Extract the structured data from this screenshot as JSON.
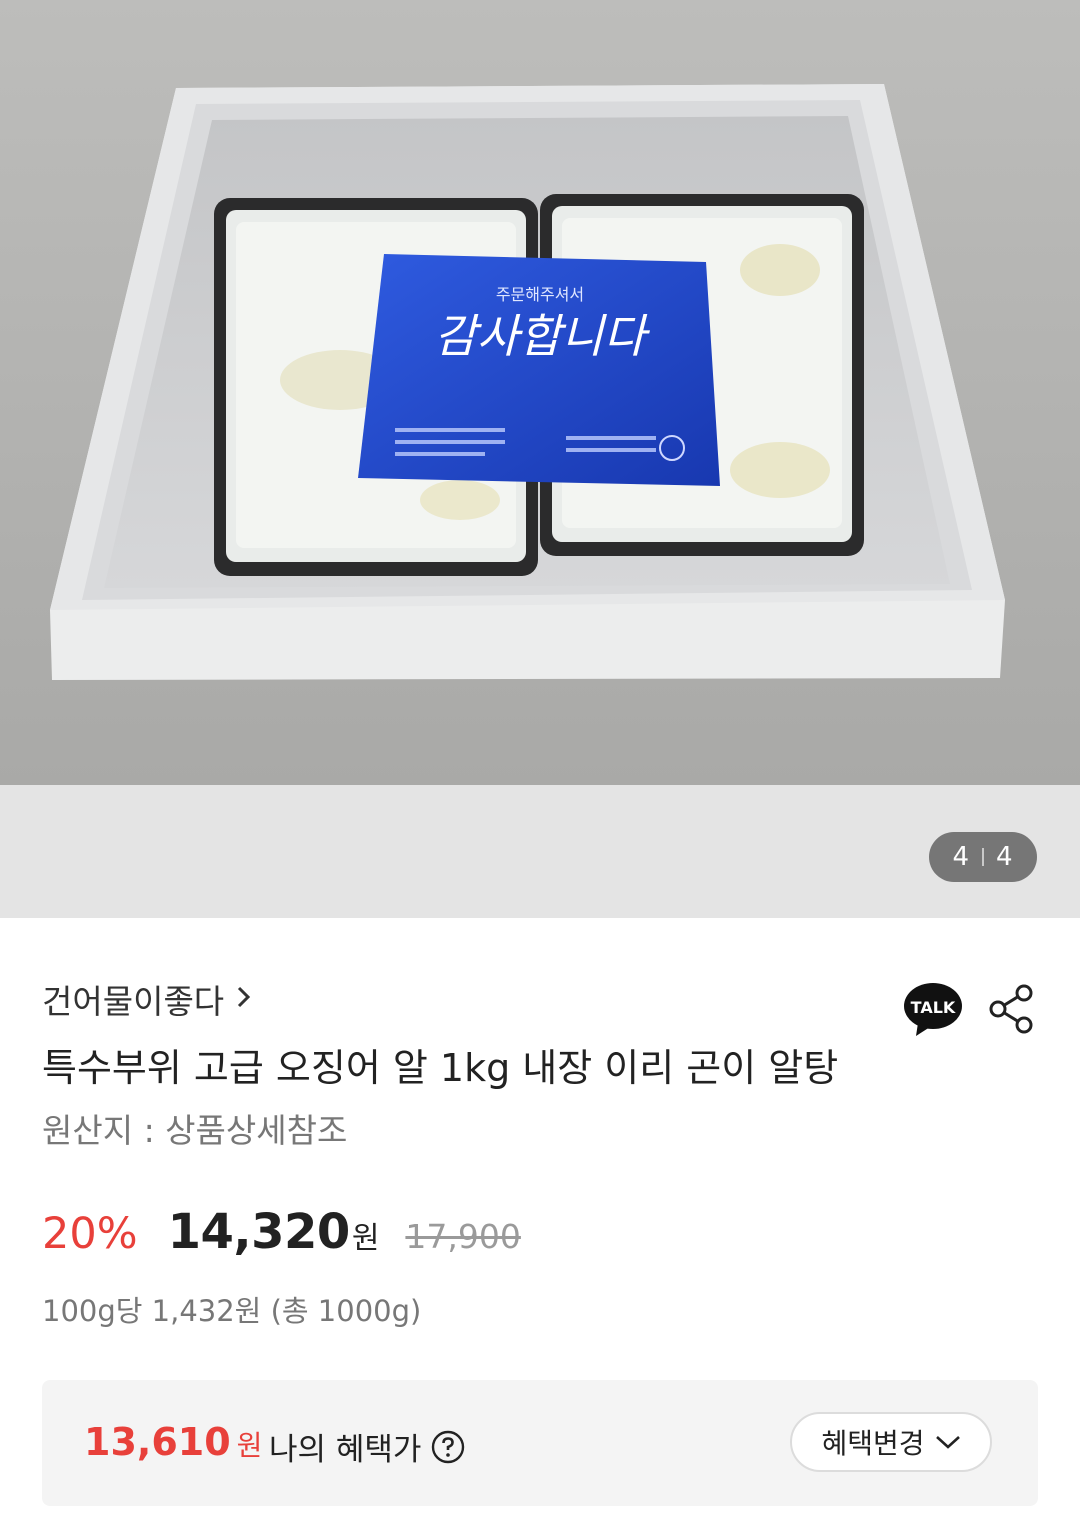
{
  "gallery": {
    "current": "4",
    "total": "4",
    "image": {
      "ice_pack_line1": "주문해주셔서",
      "ice_pack_line2": "감사합니다"
    }
  },
  "product": {
    "seller": "건어물이좋다",
    "title": "특수부위 고급 오징어 알 1kg 내장 이리 곤이 알탕",
    "origin": "원산지 : 상품상세참조",
    "discount": "20%",
    "price": "14,320",
    "currency": "원",
    "original_price": "17,900",
    "unit_price": "100g당 1,432원 (총 1000g)"
  },
  "benefit": {
    "price": "13,610",
    "currency": "원",
    "label": "나의 혜택가",
    "change_label": "혜택변경"
  },
  "talk": {
    "label": "TALK"
  },
  "colors": {
    "accent": "#e8403a",
    "counter_bg": "#767676",
    "ice_pack": "#1e47c8"
  },
  "icons": [
    "chevron-right-icon",
    "talk-icon",
    "share-icon",
    "help-icon",
    "chevron-down-icon"
  ]
}
